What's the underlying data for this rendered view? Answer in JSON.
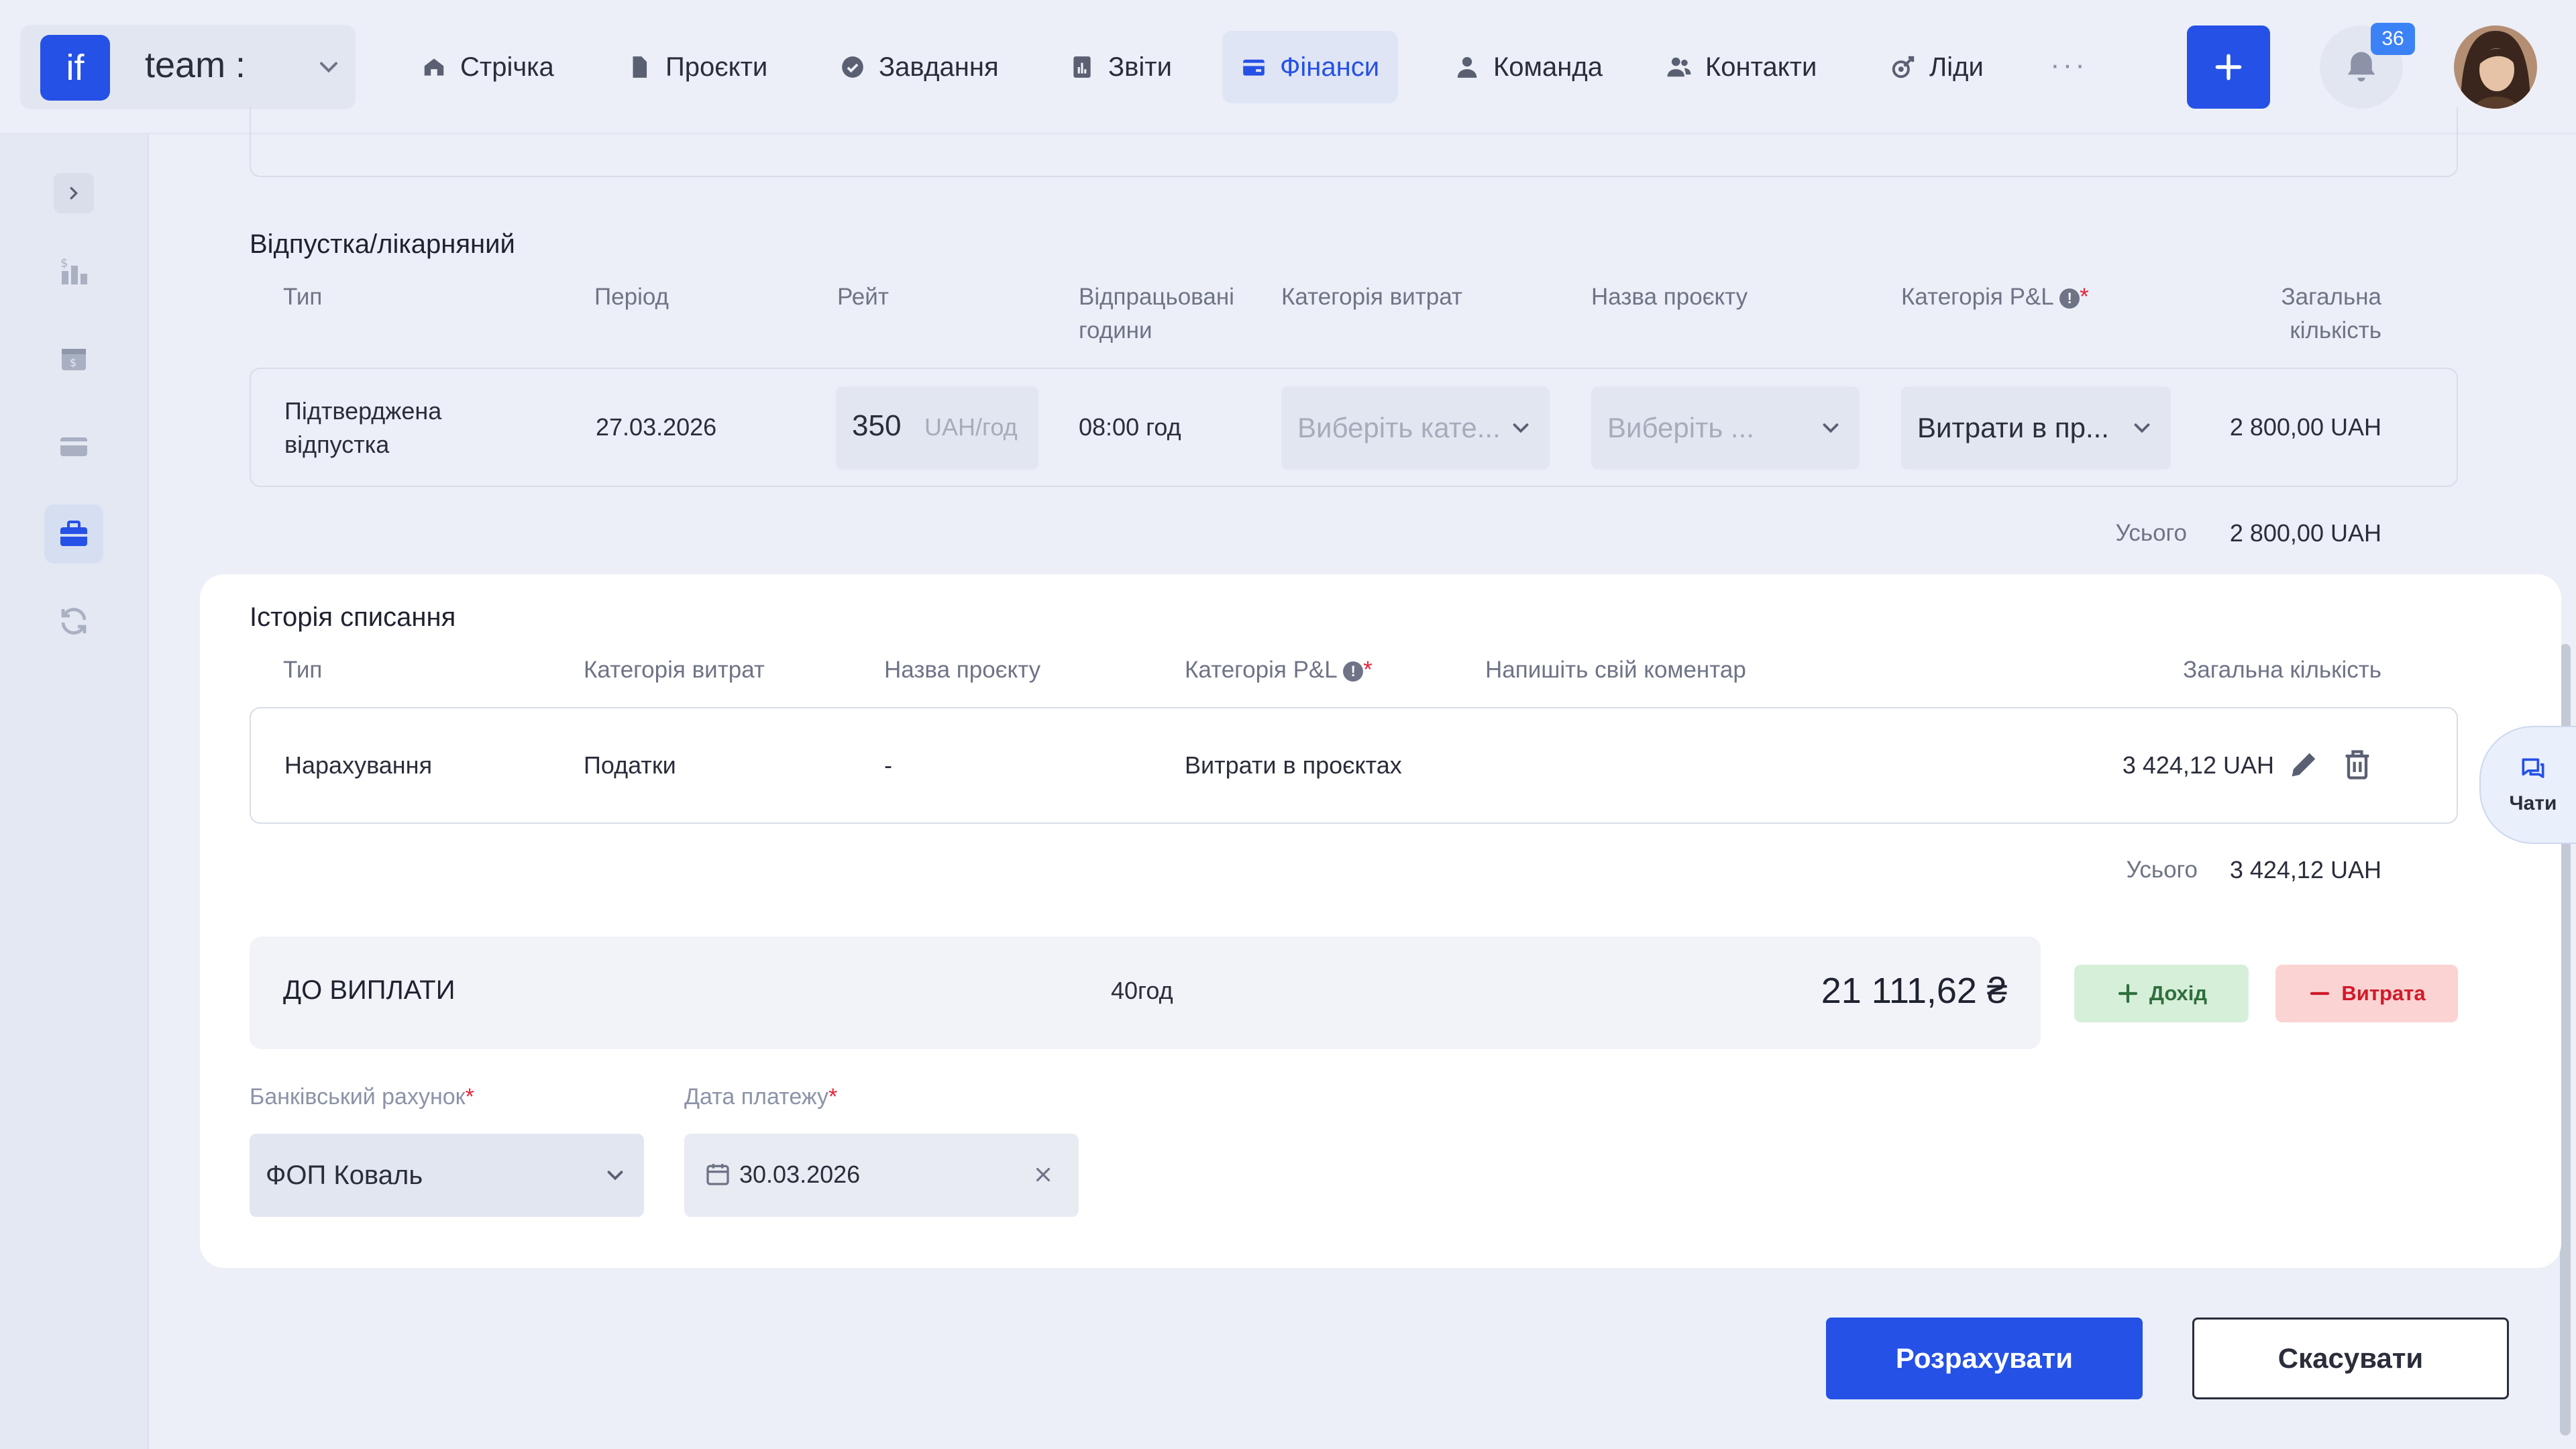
{
  "workspace": {
    "logo": "if",
    "name": "team :"
  },
  "nav": {
    "items": [
      {
        "label": "Стрічка",
        "icon": "home-icon"
      },
      {
        "label": "Проєкти",
        "icon": "file-icon"
      },
      {
        "label": "Завдання",
        "icon": "check-circle-icon"
      },
      {
        "label": "Звіти",
        "icon": "report-icon"
      },
      {
        "label": "Фінанси",
        "icon": "wallet-icon",
        "active": true
      },
      {
        "label": "Команда",
        "icon": "user-icon"
      },
      {
        "label": "Контакти",
        "icon": "contacts-icon"
      },
      {
        "label": "Ліди",
        "icon": "leads-icon"
      }
    ],
    "more": "···",
    "notifications_count": "36"
  },
  "leave": {
    "title": "Відпустка/лікарняний",
    "headers": {
      "type": "Тип",
      "period": "Період",
      "rate": "Рейт",
      "hours_line1": "Відпрацьовані",
      "hours_line2": "години",
      "expense_category": "Категорія витрат",
      "project_name": "Назва проєкту",
      "pl_category": "Категорія P&L",
      "total_line1": "Загальна",
      "total_line2": "кількість"
    },
    "row": {
      "type_line1": "Підтверджена",
      "type_line2": "відпустка",
      "period": "27.03.2026",
      "rate_value": "350",
      "rate_unit": "UAH/год",
      "hours": "08:00 год",
      "expense_category_placeholder": "Виберіть кате...",
      "project_placeholder": "Виберіть ...",
      "pl_category": "Витрати в пр...",
      "total": "2 800,00 UAH"
    },
    "sum_label": "Усього",
    "sum_value": "2 800,00 UAH"
  },
  "history": {
    "title": "Історія списання",
    "headers": {
      "type": "Тип",
      "expense_category": "Категорія витрат",
      "project_name": "Назва проєкту",
      "pl_category": "Категорія P&L",
      "comment": "Напишіть свій коментар",
      "total": "Загальна кількість"
    },
    "row": {
      "type": "Нарахування",
      "expense_category": "Податки",
      "project_name": "-",
      "pl_category": "Витрати в проєктах",
      "total": "3 424,12 UAH"
    },
    "sum_label": "Усього",
    "sum_value": "3 424,12 UAH"
  },
  "payout": {
    "label": "ДО ВИПЛАТИ",
    "hours": "40год",
    "amount": "21 111,62 ₴",
    "income_label": "Дохід",
    "expense_label": "Витрата"
  },
  "bank": {
    "label": "Банківський рахунок",
    "value": "ФОП Коваль"
  },
  "payment_date": {
    "label": "Дата платежу",
    "value": "30.03.2026"
  },
  "actions": {
    "calculate": "Розрахувати",
    "cancel": "Скасувати"
  },
  "chats": {
    "label": "Чати"
  },
  "colors": {
    "accent": "#2551e6",
    "income": "#d6efd9",
    "expense": "#fbd3d3",
    "required": "#e5253a"
  }
}
